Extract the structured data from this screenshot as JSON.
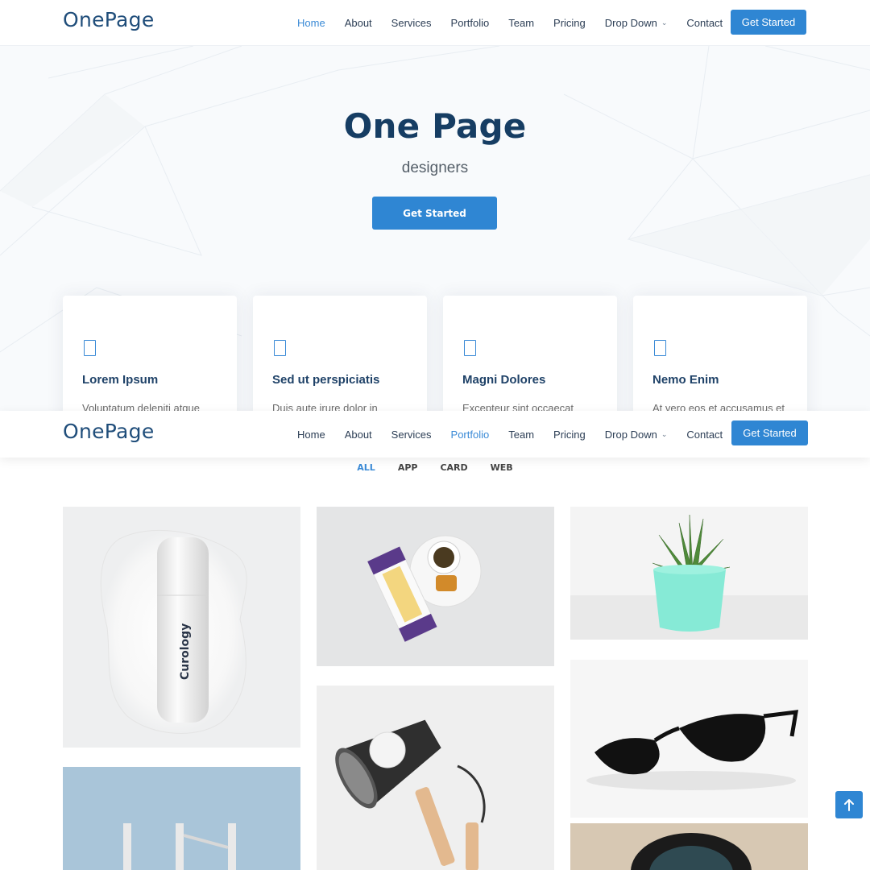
{
  "brand": {
    "logo": "OnePage"
  },
  "nav": {
    "items": [
      {
        "label": "Home"
      },
      {
        "label": "About"
      },
      {
        "label": "Services"
      },
      {
        "label": "Portfolio"
      },
      {
        "label": "Team"
      },
      {
        "label": "Pricing"
      },
      {
        "label": "Drop Down"
      },
      {
        "label": "Contact"
      }
    ],
    "cta": "Get Started",
    "active_top": "Home",
    "active_sticky": "Portfolio"
  },
  "hero": {
    "title": "One Page",
    "subtitle": "designers",
    "button": "Get Started"
  },
  "features": [
    {
      "title": "Lorem Ipsum",
      "text": "Voluptatum deleniti atque",
      "icon": "feature-icon"
    },
    {
      "title": "Sed ut perspiciatis",
      "text": "Duis aute irure dolor in",
      "icon": "feature-icon"
    },
    {
      "title": "Magni Dolores",
      "text": "Excepteur sint occaecat",
      "icon": "feature-icon"
    },
    {
      "title": "Nemo Enim",
      "text": "At vero eos et accusamus et",
      "icon": "feature-icon"
    }
  ],
  "portfolio": {
    "filters": [
      "ALL",
      "APP",
      "CARD",
      "WEB"
    ],
    "active_filter": "ALL",
    "items": [
      {
        "name": "curology-bottle",
        "label": "Curology"
      },
      {
        "name": "honeycomb-tea"
      },
      {
        "name": "succulent-plant"
      },
      {
        "name": "desk-lamp"
      },
      {
        "name": "sunglasses"
      },
      {
        "name": "stool"
      },
      {
        "name": "camera-lens"
      }
    ]
  },
  "colors": {
    "accent": "#2f86d3",
    "heading": "#163d63",
    "nav_text": "#2c3e55"
  }
}
